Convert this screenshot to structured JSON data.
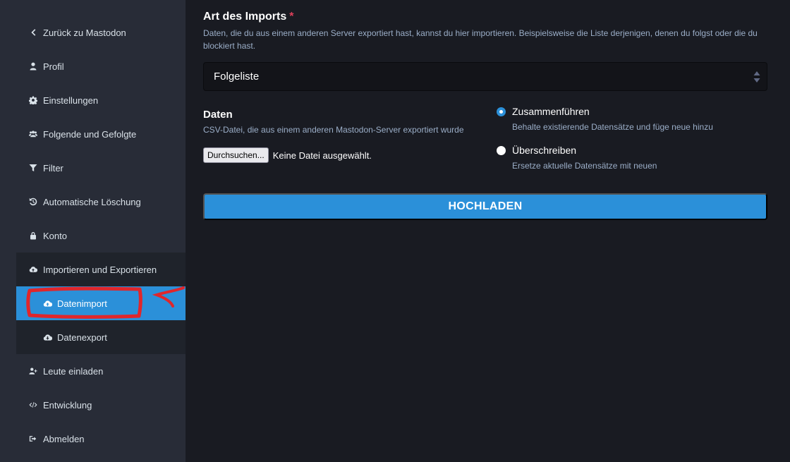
{
  "sidebar": {
    "items": [
      {
        "label": "Zurück zu Mastodon",
        "icon": "chevron-left-icon"
      },
      {
        "label": "Profil",
        "icon": "user-icon"
      },
      {
        "label": "Einstellungen",
        "icon": "gear-icon"
      },
      {
        "label": "Folgende und Gefolgte",
        "icon": "users-icon"
      },
      {
        "label": "Filter",
        "icon": "filter-icon"
      },
      {
        "label": "Automatische Löschung",
        "icon": "history-icon"
      },
      {
        "label": "Konto",
        "icon": "lock-icon"
      },
      {
        "label": "Importieren und Exportieren",
        "icon": "cloud-upload-icon"
      }
    ],
    "sub_items": [
      {
        "label": "Datenimport",
        "icon": "cloud-upload-icon",
        "active": true
      },
      {
        "label": "Datenexport",
        "icon": "cloud-download-icon",
        "active": false
      }
    ],
    "bottom_items": [
      {
        "label": "Leute einladen",
        "icon": "user-plus-icon"
      },
      {
        "label": "Entwicklung",
        "icon": "code-icon"
      },
      {
        "label": "Abmelden",
        "icon": "sign-out-icon"
      }
    ]
  },
  "form": {
    "import_type": {
      "title": "Art des Imports",
      "required_mark": "*",
      "hint": "Daten, die du aus einem anderen Server exportiert hast, kannst du hier importieren. Beispielsweise die Liste derjenigen, denen du folgst oder die du blockiert hast.",
      "selected": "Folgeliste"
    },
    "data": {
      "title": "Daten",
      "hint": "CSV-Datei, die aus einem anderen Mastodon-Server exportiert wurde",
      "browse_label": "Durchsuchen...",
      "file_status": "Keine Datei ausgewählt."
    },
    "mode": {
      "options": [
        {
          "label": "Zusammenführen",
          "hint": "Behalte existierende Datensätze und füge neue hinzu",
          "checked": true
        },
        {
          "label": "Überschreiben",
          "hint": "Ersetze aktuelle Datensätze mit neuen",
          "checked": false
        }
      ]
    },
    "submit_label": "HOCHLADEN"
  },
  "colors": {
    "accent": "#2b90d9",
    "sidebar_bg": "#282c37",
    "page_bg": "#191b22",
    "annotation": "#e0262b"
  }
}
